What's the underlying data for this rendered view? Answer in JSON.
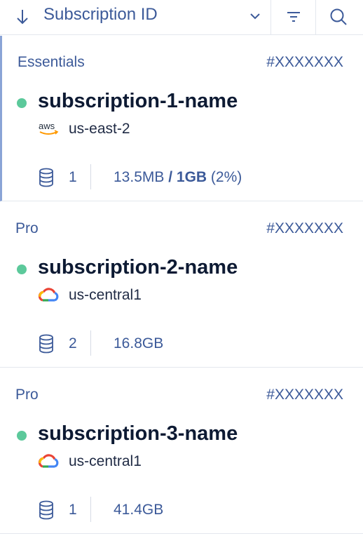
{
  "header": {
    "sort_label": "Subscription ID",
    "sort_direction": "descending",
    "icons": [
      "arrow-down-icon",
      "chevron-down-icon",
      "filter-icon",
      "search-icon"
    ]
  },
  "colors": {
    "accent": "#3c5a99",
    "status_active": "#5cc99b",
    "divider": "#e3e7ee"
  },
  "subscriptions": [
    {
      "plan": "Essentials",
      "id": "#XXXXXXX",
      "name": "subscription-1-name",
      "status": "active",
      "provider_icon": "aws-icon",
      "provider_text": "aws",
      "region": "us-east-2",
      "db_count": "1",
      "usage_used": "13.5MB",
      "usage_sep": " / ",
      "usage_total": "1GB",
      "usage_pct": " (2%)"
    },
    {
      "plan": "Pro",
      "id": "#XXXXXXX",
      "name": "subscription-2-name",
      "status": "active",
      "provider_icon": "google-cloud-icon",
      "region": "us-central1",
      "db_count": "2",
      "usage_used": "16.8GB"
    },
    {
      "plan": "Pro",
      "id": "#XXXXXXX",
      "name": "subscription-3-name",
      "status": "active",
      "provider_icon": "google-cloud-icon",
      "region": "us-central1",
      "db_count": "1",
      "usage_used": "41.4GB"
    }
  ]
}
